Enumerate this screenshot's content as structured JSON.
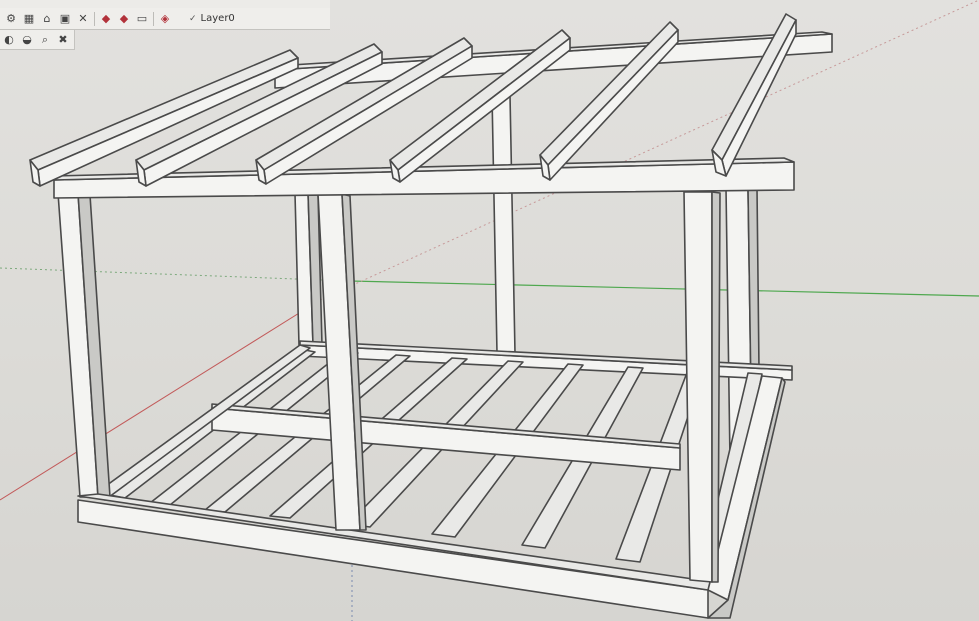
{
  "toolbar": {
    "layer_name": "Layer0",
    "row1_icons": [
      "folder-open-icon",
      "save-icon",
      "home-icon",
      "3d-warehouse-icon",
      "component-icon"
    ],
    "row2_icons": [
      "axes-icon",
      "grid-icon",
      "group-icon",
      "delete-icon",
      "ruby-icon",
      "gem-icon",
      "print-icon",
      "extension-icon"
    ],
    "left_icons": [
      "paint-bucket-icon",
      "tape-measure-icon",
      "zoom-icon",
      "erase-icon"
    ]
  },
  "viewport": {
    "background_color": "#dcdbd7",
    "axis_colors": {
      "green_axis": "#4fa84f",
      "red_axis": "#c25a5a",
      "blue_axis_dotted": "#7a8ab0"
    }
  }
}
